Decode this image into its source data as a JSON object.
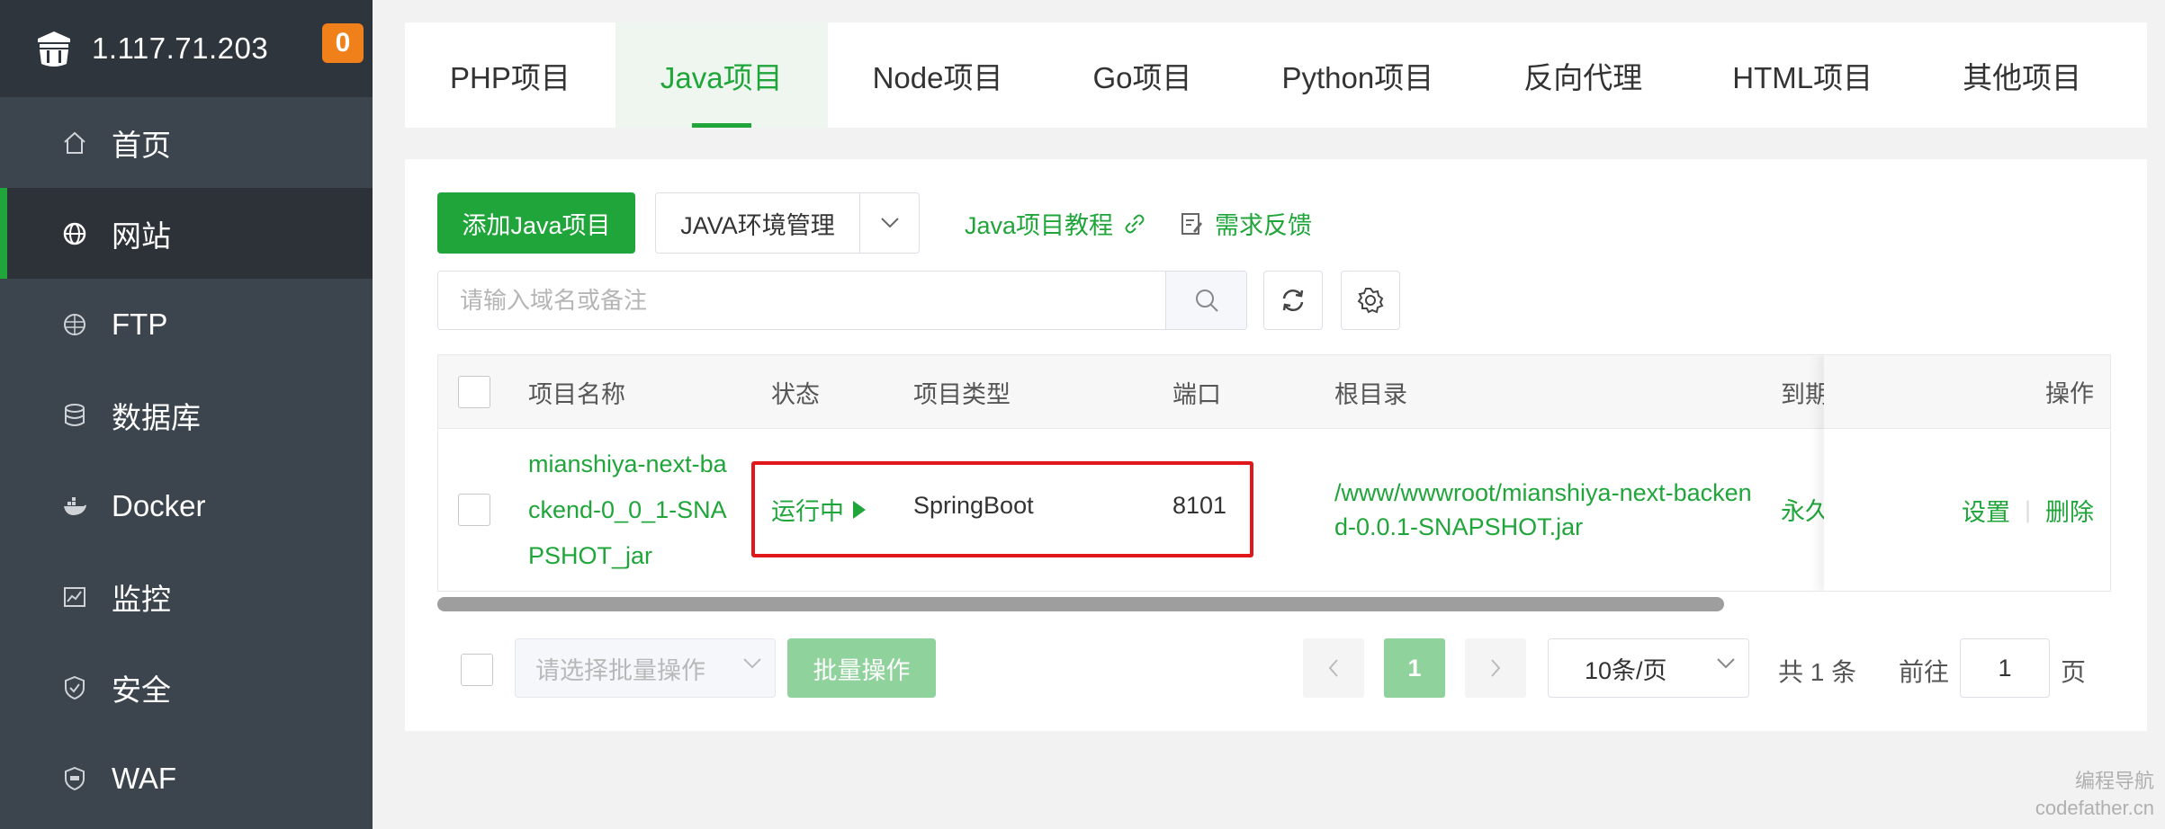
{
  "sidebar": {
    "ip": "1.117.71.203",
    "badge": "0",
    "items": [
      {
        "label": "首页",
        "icon": "home-icon"
      },
      {
        "label": "网站",
        "icon": "globe-icon"
      },
      {
        "label": "FTP",
        "icon": "ftp-icon"
      },
      {
        "label": "数据库",
        "icon": "database-icon"
      },
      {
        "label": "Docker",
        "icon": "docker-icon"
      },
      {
        "label": "监控",
        "icon": "monitor-icon"
      },
      {
        "label": "安全",
        "icon": "shield-icon"
      },
      {
        "label": "WAF",
        "icon": "waf-icon"
      }
    ]
  },
  "tabs": [
    "PHP项目",
    "Java项目",
    "Node项目",
    "Go项目",
    "Python项目",
    "反向代理",
    "HTML项目",
    "其他项目"
  ],
  "toolbar": {
    "add_label": "添加Java项目",
    "env_label": "JAVA环境管理",
    "tutorial_label": "Java项目教程",
    "feedback_label": "需求反馈",
    "search_placeholder": "请输入域名或备注"
  },
  "table": {
    "headers": {
      "name": "项目名称",
      "status": "状态",
      "type": "项目类型",
      "port": "端口",
      "root": "根目录",
      "expire": "到期",
      "ops": "操作"
    },
    "rows": [
      {
        "name": "mianshiya-next-backend-0_0_1-SNAPSHOT_jar",
        "status": "运行中",
        "type": "SpringBoot",
        "port": "8101",
        "root": "/www/wwwroot/mianshiya-next-backend-0.0.1-SNAPSHOT.jar",
        "expire": "永久",
        "op_settings": "设置",
        "op_delete": "删除"
      }
    ]
  },
  "footer": {
    "batch_placeholder": "请选择批量操作",
    "batch_button": "批量操作",
    "current_page": "1",
    "page_size": "10条/页",
    "total": "共 1 条",
    "goto_label": "前往",
    "goto_value": "1",
    "page_suffix": "页"
  },
  "watermark": {
    "line1": "编程导航",
    "line2": "codefather.cn"
  },
  "colors": {
    "accent": "#20a53a",
    "sidebar_bg": "#3c444d",
    "highlight": "#e0181c",
    "badge": "#f0801a"
  }
}
